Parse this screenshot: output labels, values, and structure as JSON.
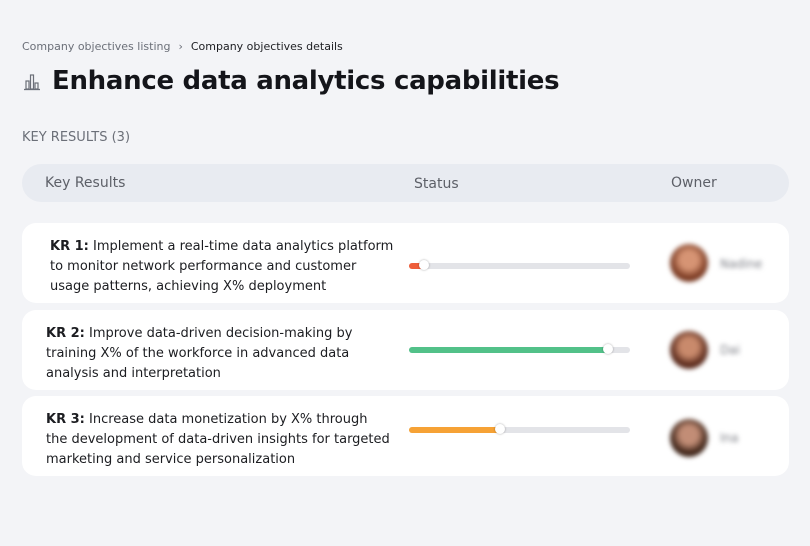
{
  "breadcrumb": {
    "parent": "Company objectives listing",
    "separator": "›",
    "current": "Company objectives details"
  },
  "page": {
    "title": "Enhance data analytics capabilities",
    "title_icon": "bar-chart-icon"
  },
  "section": {
    "label": "KEY RESULTS (3)"
  },
  "table": {
    "headers": {
      "key_results": "Key Results",
      "status": "Status",
      "owner": "Owner"
    },
    "rows": [
      {
        "kr": "KR 1:",
        "text": " Implement a real-time data analytics platform to monitor network performance and customer usage patterns, achieving X% deployment",
        "progress": 0.07,
        "progress_color": "#ee5d3a",
        "owner_name": "Nadine",
        "avatar_colors": [
          "#7a3a22",
          "#d69474"
        ]
      },
      {
        "kr": "KR 2:",
        "text": " Improve data-driven decision-making by training X% of the workforce in advanced data analysis and interpretation",
        "progress": 0.9,
        "progress_color": "#52c189",
        "owner_name": "Dai",
        "avatar_colors": [
          "#5a2a1c",
          "#c98a6c"
        ]
      },
      {
        "kr": "KR 3:",
        "text": " Increase data monetization by X% through the development of data-driven insights for targeted marketing and service personalization",
        "progress": 0.41,
        "progress_color": "#f6a235",
        "owner_name": "Ina",
        "avatar_colors": [
          "#3e2418",
          "#c28d76"
        ]
      }
    ]
  }
}
